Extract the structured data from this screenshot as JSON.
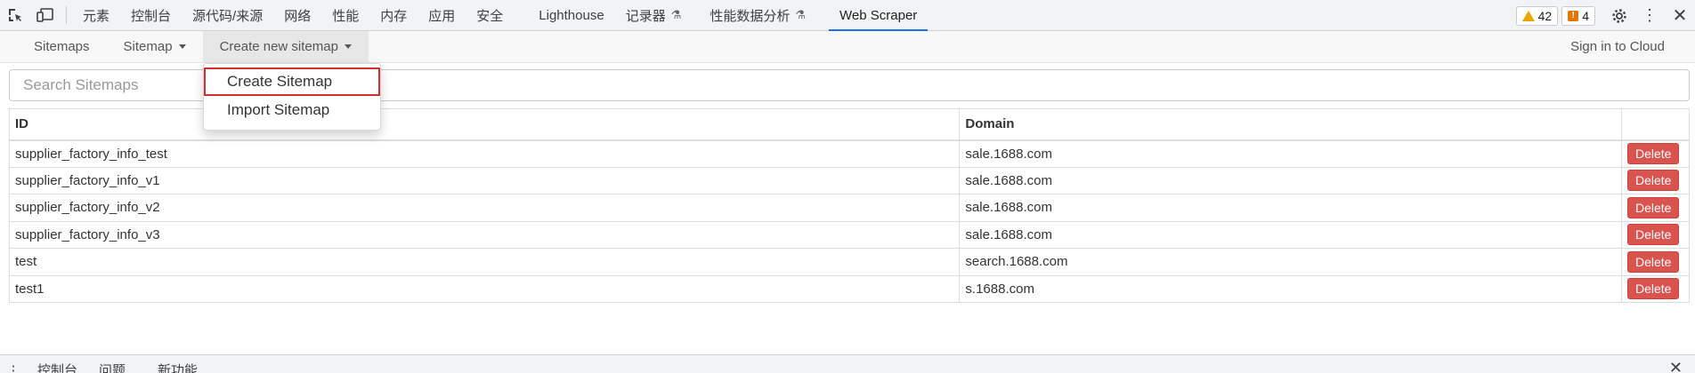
{
  "devtools": {
    "tabs": [
      {
        "label": "元素"
      },
      {
        "label": "控制台"
      },
      {
        "label": "源代码/来源"
      },
      {
        "label": "网络"
      },
      {
        "label": "性能"
      },
      {
        "label": "内存"
      },
      {
        "label": "应用"
      },
      {
        "label": "安全"
      },
      {
        "label": "Lighthouse"
      },
      {
        "label": "记录器"
      },
      {
        "label": "性能数据分析"
      },
      {
        "label": "Web Scraper"
      }
    ],
    "warnings_count": "42",
    "issues_count": "4",
    "active_tab": "Web Scraper",
    "accent_color": "#1a73e8"
  },
  "nav": {
    "sitemaps": "Sitemaps",
    "sitemap": "Sitemap",
    "create_new_sitemap": "Create new sitemap",
    "sign_in": "Sign in to Cloud"
  },
  "dropdown": {
    "create": "Create Sitemap",
    "import": "Import Sitemap"
  },
  "search": {
    "placeholder": "Search Sitemaps"
  },
  "table": {
    "headers": {
      "id": "ID",
      "domain": "Domain"
    },
    "rows": [
      {
        "id": "supplier_factory_info_test",
        "domain": "sale.1688.com",
        "action": "Delete"
      },
      {
        "id": "supplier_factory_info_v1",
        "domain": "sale.1688.com",
        "action": "Delete"
      },
      {
        "id": "supplier_factory_info_v2",
        "domain": "sale.1688.com",
        "action": "Delete"
      },
      {
        "id": "supplier_factory_info_v3",
        "domain": "sale.1688.com",
        "action": "Delete"
      },
      {
        "id": "test",
        "domain": "search.1688.com",
        "action": "Delete"
      },
      {
        "id": "test1",
        "domain": "s.1688.com",
        "action": "Delete"
      }
    ],
    "delete_color": "#d9534f"
  },
  "drawer": {
    "tabs": [
      {
        "label": "控制台"
      },
      {
        "label": "问题"
      },
      {
        "label": "新功能"
      }
    ]
  }
}
